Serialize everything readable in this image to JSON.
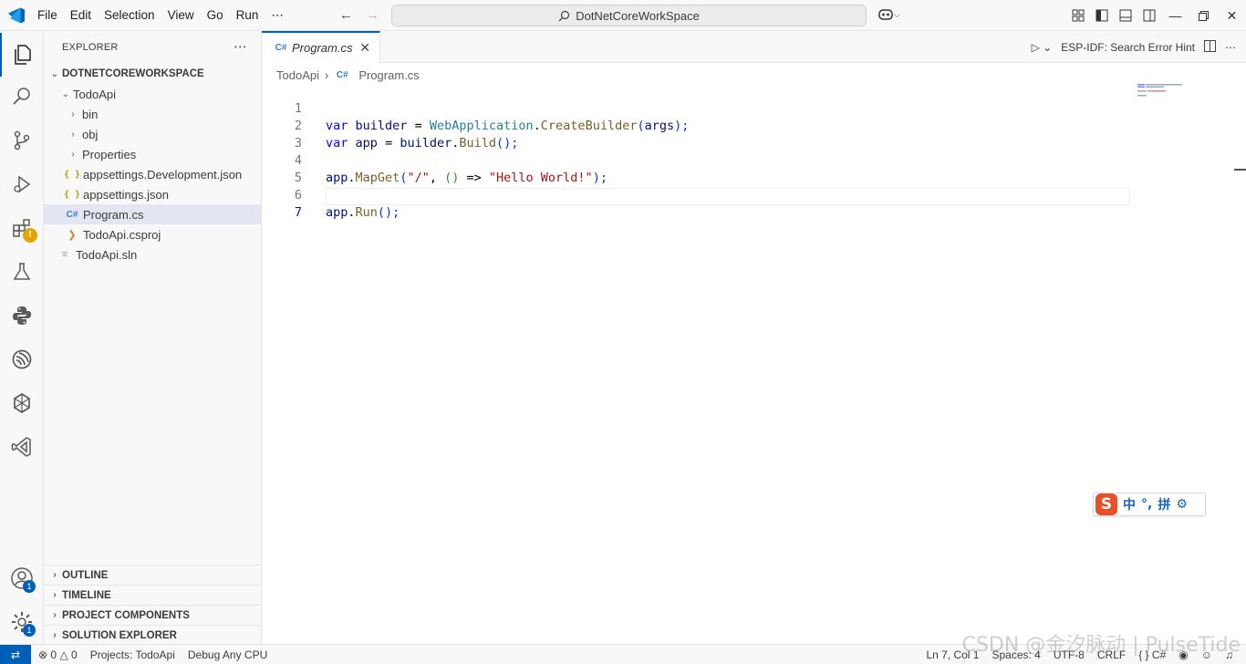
{
  "menu": [
    "File",
    "Edit",
    "Selection",
    "View",
    "Go",
    "Run",
    "⋯"
  ],
  "command_center": "DotNetCoreWorkSpace",
  "sidebar": {
    "title": "EXPLORER",
    "workspace": "DOTNETCOREWORKSPACE",
    "tree": [
      {
        "label": "TodoApi",
        "kind": "folder-open"
      },
      {
        "label": "bin",
        "kind": "folder"
      },
      {
        "label": "obj",
        "kind": "folder"
      },
      {
        "label": "Properties",
        "kind": "folder"
      },
      {
        "label": "appsettings.Development.json",
        "kind": "json"
      },
      {
        "label": "appsettings.json",
        "kind": "json"
      },
      {
        "label": "Program.cs",
        "kind": "cs"
      },
      {
        "label": "TodoApi.csproj",
        "kind": "csproj"
      },
      {
        "label": "TodoApi.sln",
        "kind": "sln"
      }
    ],
    "sections": [
      "OUTLINE",
      "TIMELINE",
      "PROJECT COMPONENTS",
      "SOLUTION EXPLORER"
    ]
  },
  "activity_badges": {
    "accounts": "1",
    "manage": "1"
  },
  "editor": {
    "tab": "Program.cs",
    "breadcrumb": [
      "TodoApi",
      "Program.cs"
    ],
    "hint": "ESP-IDF: Search Error Hint",
    "line_numbers": [
      "1",
      "2",
      "3",
      "4",
      "5",
      "6",
      "7"
    ],
    "code": {
      "l1": [
        "var",
        "builder",
        "=",
        "WebApplication",
        ".",
        "CreateBuilder",
        "(",
        "args",
        ");"
      ],
      "l2": [
        "var",
        "app",
        "=",
        "builder",
        ".",
        "Build",
        "();"
      ],
      "l4": [
        "app",
        ".",
        "MapGet",
        "(",
        "\"/\"",
        ", ",
        "()",
        " => ",
        "\"Hello World!\"",
        ");"
      ],
      "l6": [
        "app",
        ".",
        "Run",
        "();"
      ]
    }
  },
  "ime": {
    "lang": "中",
    "punct": "°,",
    "mode": "拼"
  },
  "status": {
    "errors": "0",
    "warnings": "0",
    "projects": "Projects: TodoApi",
    "config": "Debug Any CPU",
    "position": "Ln 7, Col 1",
    "spaces": "Spaces: 4",
    "encoding": "UTF-8",
    "eol": "CRLF",
    "language": "C#"
  },
  "watermark": "CSDN @金汐脉动 | PulseTide"
}
